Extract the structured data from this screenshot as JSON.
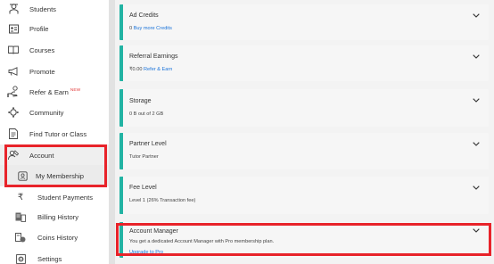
{
  "sidebar": {
    "items": [
      {
        "label": "Students",
        "icon": "students-icon"
      },
      {
        "label": "Profile",
        "icon": "profile-icon"
      },
      {
        "label": "Courses",
        "icon": "courses-icon"
      },
      {
        "label": "Promote",
        "icon": "promote-icon"
      },
      {
        "label": "Refer & Earn",
        "icon": "refer-icon",
        "badge": "NEW"
      },
      {
        "label": "Community",
        "icon": "community-icon"
      },
      {
        "label": "Find Tutor or Class",
        "icon": "find-tutor-icon"
      },
      {
        "label": "Account",
        "icon": "account-icon"
      },
      {
        "label": "My Membership",
        "icon": "membership-icon"
      },
      {
        "label": "Student Payments",
        "icon": "rupee-icon"
      },
      {
        "label": "Billing History",
        "icon": "billing-icon"
      },
      {
        "label": "Coins History",
        "icon": "coins-icon"
      },
      {
        "label": "Settings",
        "icon": "settings-icon"
      }
    ]
  },
  "cards": [
    {
      "title": "Ad Credits",
      "text": "0",
      "link": "Buy more Credits"
    },
    {
      "title": "Referral Earnings",
      "text": "₹0.00",
      "link": "Refer & Earn"
    },
    {
      "title": "Storage",
      "text": "0 B out of 2 GB",
      "link": ""
    },
    {
      "title": "Partner Level",
      "text": "Tutor Partner",
      "link": ""
    },
    {
      "title": "Fee Level",
      "text": "Level 1 (26% Transaction fee)",
      "link": ""
    },
    {
      "title": "Account Manager",
      "text": "You get a dedicated Account Manager with Pro membership plan.",
      "link": "Upgrade to Pro"
    }
  ],
  "colors": {
    "accent": "#22b3a3",
    "highlight": "#e8232a",
    "link": "#1a73d9",
    "badge": "#e23b3b"
  }
}
